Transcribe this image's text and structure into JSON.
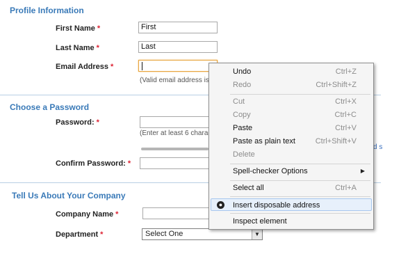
{
  "sections": {
    "profile_title": "Profile Information",
    "password_title": "Choose a Password",
    "company_title": "Tell Us About Your Company"
  },
  "profile": {
    "first_name_label": "First Name",
    "first_name_value": "First",
    "last_name_label": "Last Name",
    "last_name_value": "Last",
    "email_label": "Email Address",
    "email_value": "",
    "email_hint": "(Valid email address is r"
  },
  "password": {
    "password_label": "Password:",
    "password_hint": "(Enter at least 6 charact",
    "confirm_label": "Confirm Password:",
    "side_link": "d s"
  },
  "company": {
    "company_name_label": "Company Name",
    "department_label": "Department",
    "department_selected": "Select One"
  },
  "required_marker": "*",
  "context_menu": {
    "undo": {
      "label": "Undo",
      "shortcut": "Ctrl+Z"
    },
    "redo": {
      "label": "Redo",
      "shortcut": "Ctrl+Shift+Z"
    },
    "cut": {
      "label": "Cut",
      "shortcut": "Ctrl+X"
    },
    "copy": {
      "label": "Copy",
      "shortcut": "Ctrl+C"
    },
    "paste": {
      "label": "Paste",
      "shortcut": "Ctrl+V"
    },
    "paste_plain": {
      "label": "Paste as plain text",
      "shortcut": "Ctrl+Shift+V"
    },
    "delete": {
      "label": "Delete"
    },
    "spell": {
      "label": "Spell-checker Options"
    },
    "select_all": {
      "label": "Select all",
      "shortcut": "Ctrl+A"
    },
    "insert_disposable": {
      "label": "Insert disposable address",
      "icon": "disposable-email-icon"
    },
    "inspect": {
      "label": "Inspect element"
    }
  },
  "colors": {
    "section_title": "#3a7ab8",
    "required": "#dd2233",
    "focus_border": "#e7a33b",
    "menu_highlight": "#e7f0fb"
  }
}
